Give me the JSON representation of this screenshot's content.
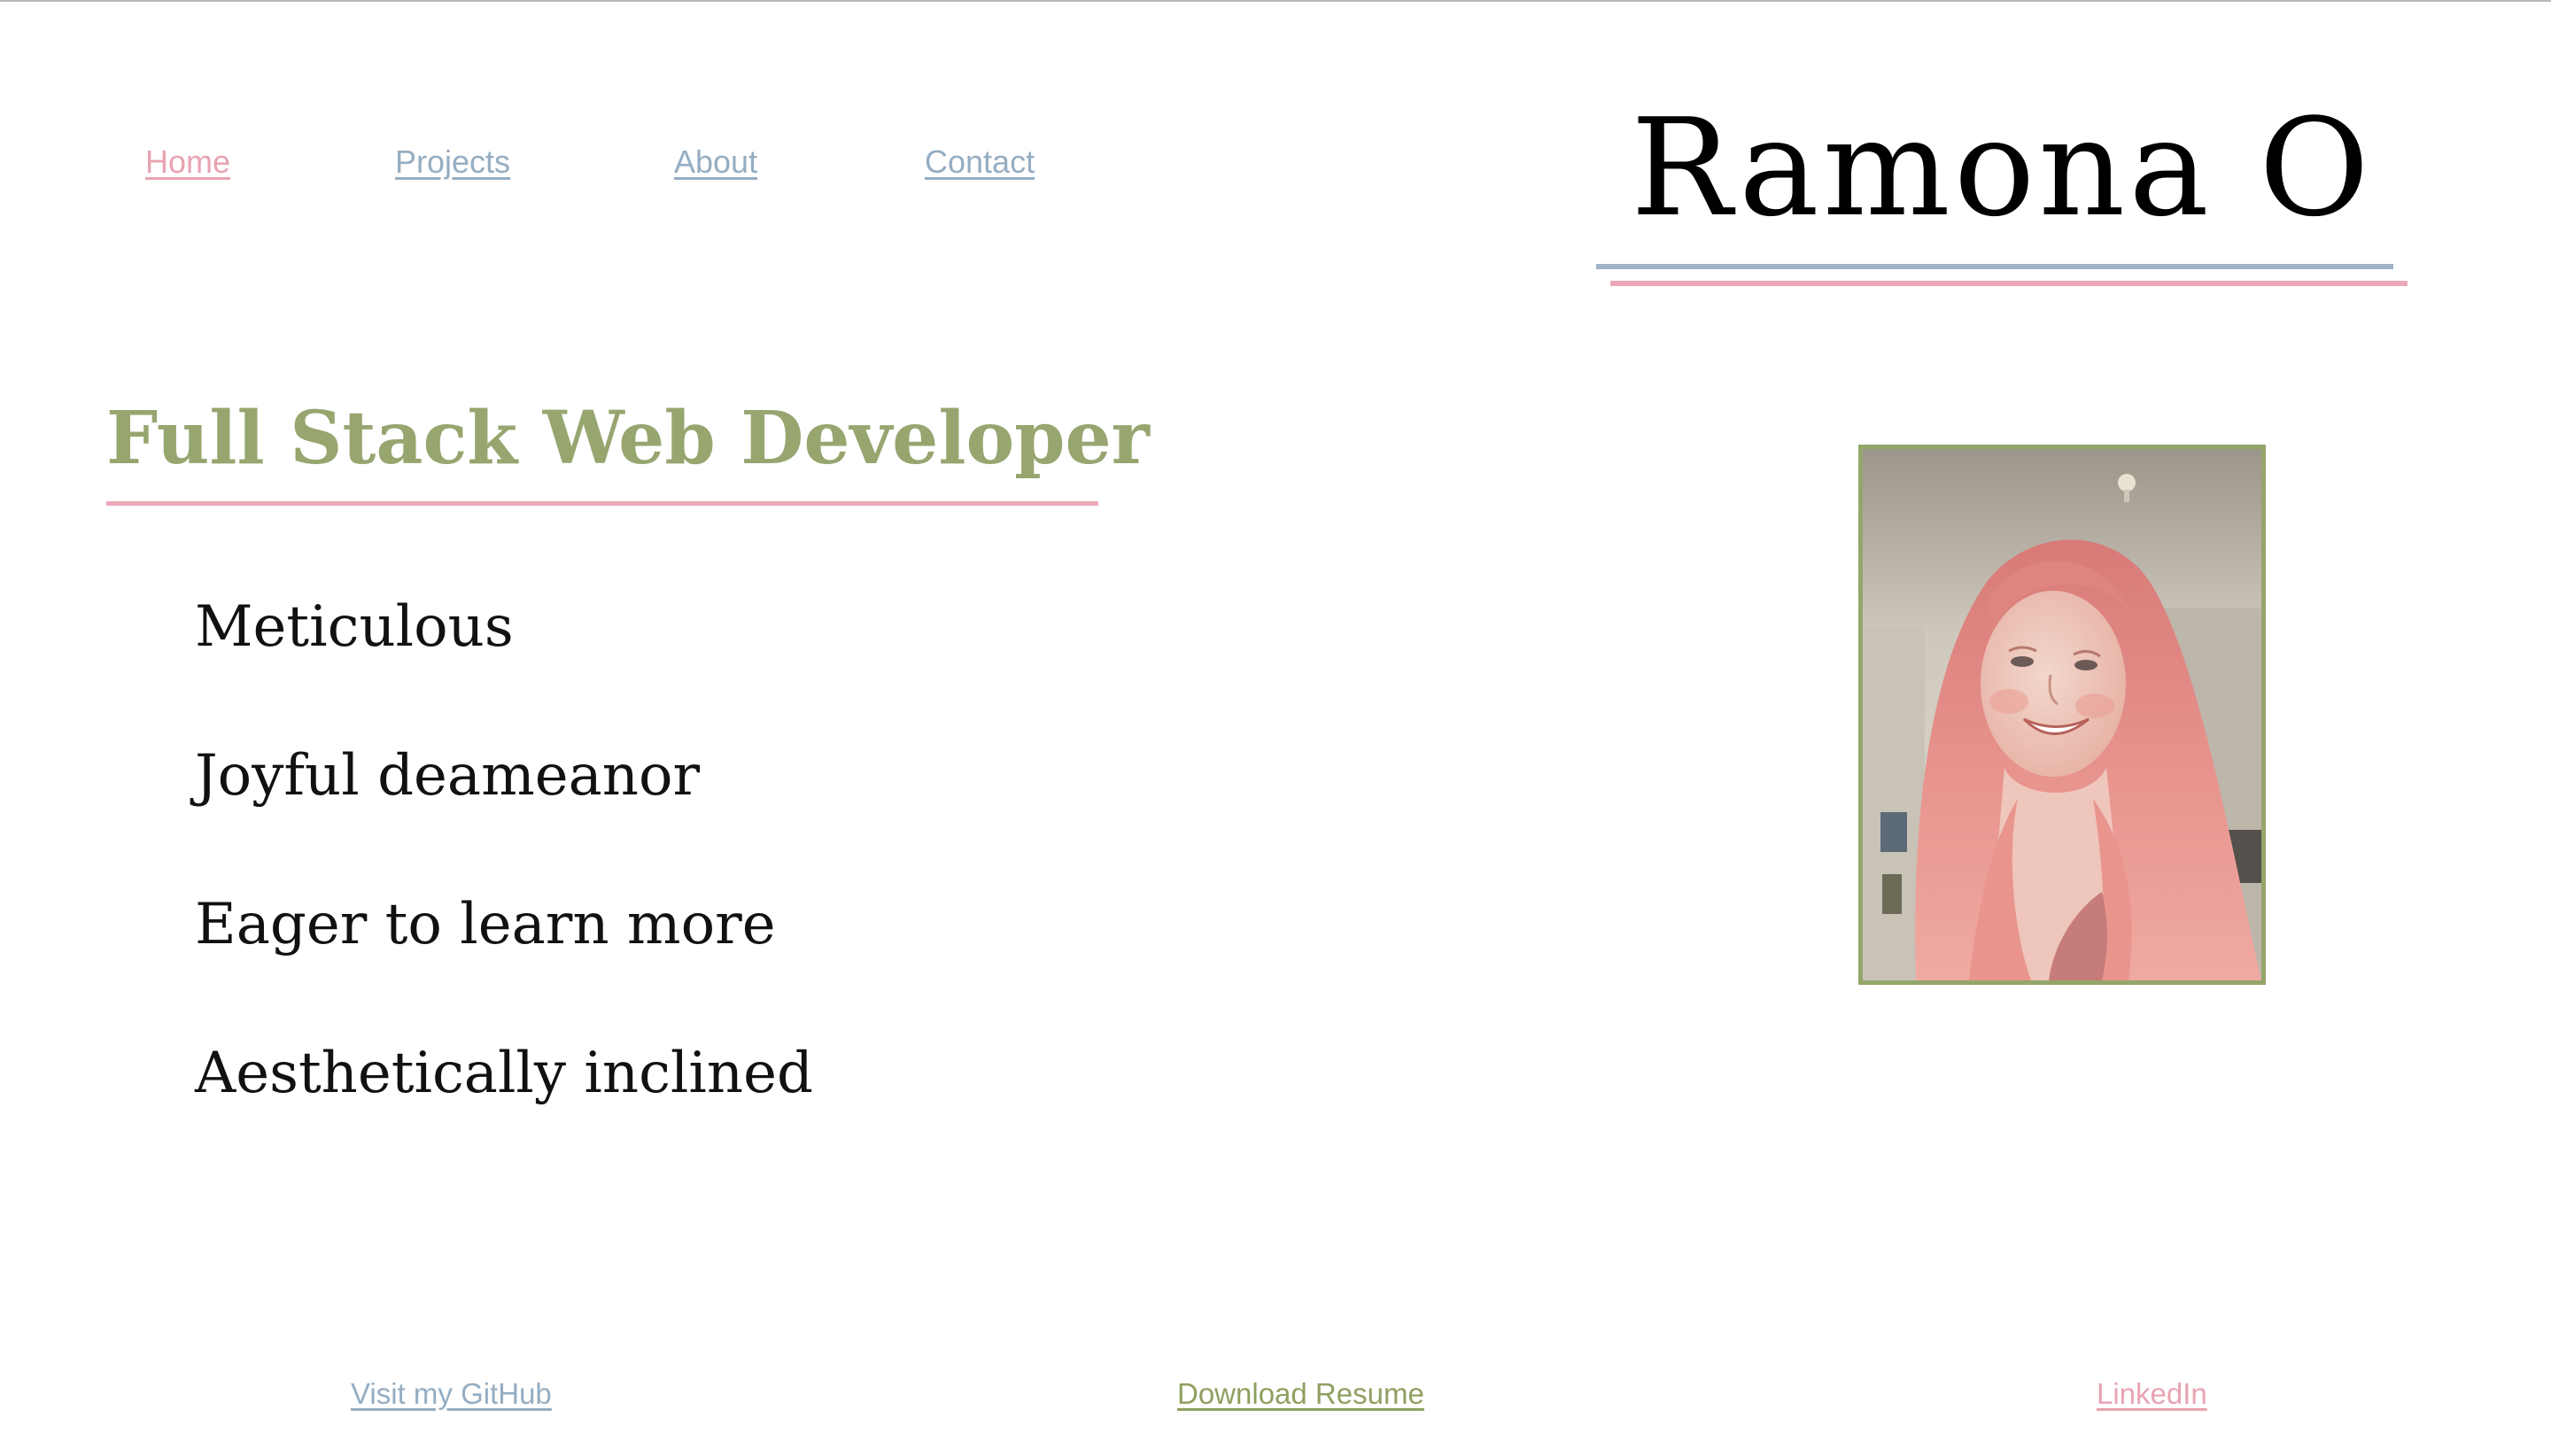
{
  "nav": {
    "items": [
      {
        "label": "Home"
      },
      {
        "label": "Projects"
      },
      {
        "label": "About"
      },
      {
        "label": "Contact"
      }
    ]
  },
  "header": {
    "name": "Ramona O"
  },
  "main": {
    "title": "Full Stack Web Developer",
    "traits": [
      "Meticulous",
      "Joyful deameanor",
      "Eager to learn more",
      "Aesthetically inclined"
    ],
    "photo_icon": "portrait-photo"
  },
  "footer": {
    "github_label": "Visit my GitHub",
    "resume_label": "Download Resume",
    "linkedin_label": "LinkedIn"
  },
  "colors": {
    "pink": "#e8a3b2",
    "blue": "#95adc2",
    "green": "#97a56f",
    "text": "#111111"
  }
}
